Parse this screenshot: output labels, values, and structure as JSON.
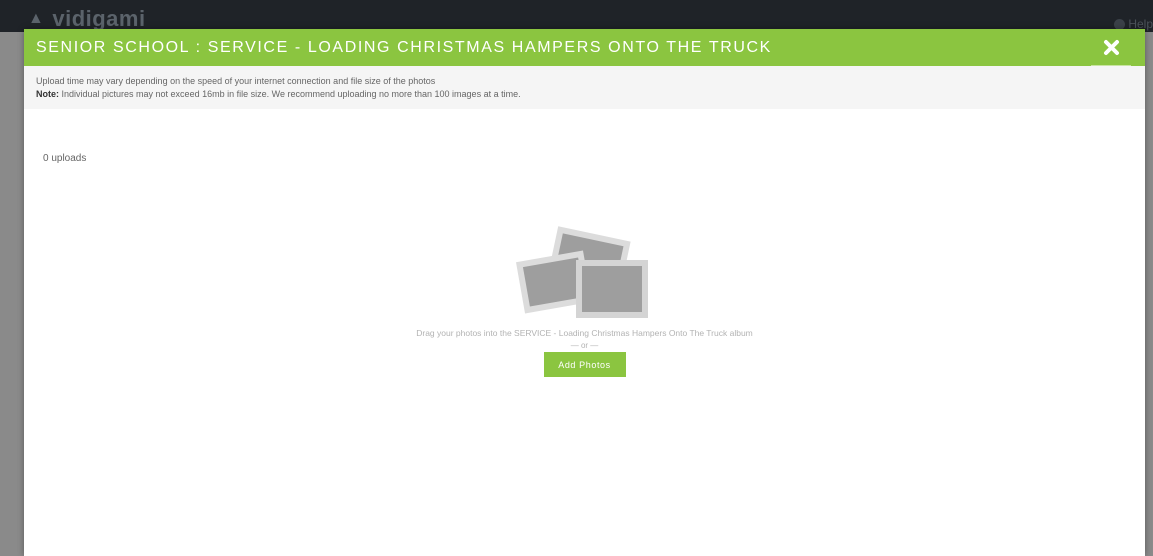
{
  "background": {
    "logo_text": "vidigami",
    "help_label": "Help"
  },
  "modal": {
    "title": "SENIOR SCHOOL : SERVICE - LOADING CHRISTMAS HAMPERS ONTO THE TRUCK",
    "close_icon": "close-x-icon",
    "info": {
      "line1": "Upload time may vary depending on the speed of your internet connection and file size of the photos",
      "note_label": "Note:",
      "note_text": " Individual pictures may not exceed 16mb in file size. We recommend uploading no more than 100 images at a time."
    },
    "uploads_count": "0 uploads",
    "dropzone": {
      "illustration_icon": "photos-stack-icon",
      "drag_text": "Drag your photos into the SERVICE - Loading Christmas Hampers Onto The Truck album",
      "or_text": "— or —",
      "add_button_label": "Add Photos"
    }
  },
  "colors": {
    "accent_green": "#8bc540",
    "header_dark": "#1f2328",
    "overlay_gray": "#8a8a8a",
    "info_bar_bg": "#f5f5f5"
  }
}
